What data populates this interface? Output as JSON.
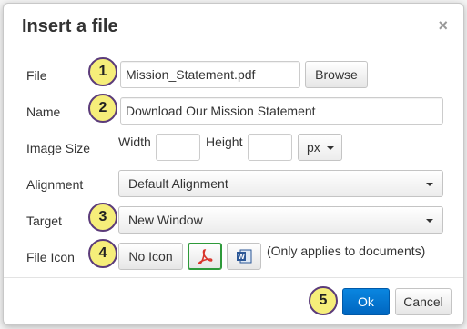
{
  "dialog": {
    "title": "Insert a file",
    "close_symbol": "×"
  },
  "form": {
    "file": {
      "label": "File",
      "value": "Mission_Statement.pdf",
      "browse_label": "Browse"
    },
    "name": {
      "label": "Name",
      "value": "Download Our Mission Statement"
    },
    "image_size": {
      "label": "Image Size",
      "width_label": "Width",
      "height_label": "Height",
      "width_value": "",
      "height_value": "",
      "unit": "px"
    },
    "alignment": {
      "label": "Alignment",
      "selected": "Default Alignment"
    },
    "target": {
      "label": "Target",
      "selected": "New Window"
    },
    "file_icon": {
      "label": "File Icon",
      "no_icon_label": "No Icon",
      "pdf_icon": "pdf-icon",
      "word_icon": "word-icon",
      "note": "(Only applies to documents)",
      "selected": "pdf-icon"
    }
  },
  "footer": {
    "ok_label": "Ok",
    "cancel_label": "Cancel"
  },
  "callouts": [
    "1",
    "2",
    "3",
    "4",
    "5"
  ],
  "colors": {
    "primary": "#0071ce",
    "callout_fill": "#f6ee7a",
    "callout_border": "#5b3b7a",
    "pdf_red": "#d9342b",
    "word_blue": "#2b5797",
    "selected_border": "#2e9a3a"
  }
}
